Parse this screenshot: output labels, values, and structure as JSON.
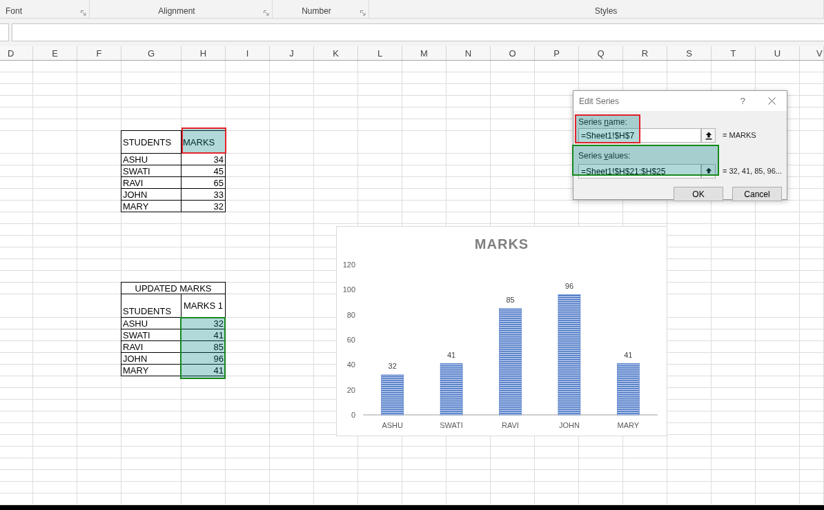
{
  "ribbon": {
    "groups": [
      {
        "label": "Font",
        "launcher": true
      },
      {
        "label": "Alignment",
        "launcher": true
      },
      {
        "label": "Number",
        "launcher": true
      },
      {
        "label": "Styles",
        "launcher": false
      }
    ]
  },
  "column_headers": [
    "D",
    "E",
    "F",
    "G",
    "H",
    "I",
    "J",
    "K",
    "L",
    "M",
    "N",
    "O",
    "P",
    "Q",
    "R",
    "S",
    "T",
    "U",
    "V"
  ],
  "table_1": {
    "columns": [
      {
        "label": "STUDENTS",
        "highlighted": false
      },
      {
        "label": "MARKS",
        "highlighted": true
      }
    ],
    "rows": [
      {
        "student": "ASHU",
        "marks": "34"
      },
      {
        "student": "SWATI",
        "marks": "45"
      },
      {
        "student": "RAVI",
        "marks": "65"
      },
      {
        "student": "JOHN",
        "marks": "33"
      },
      {
        "student": "MARY",
        "marks": "32"
      }
    ]
  },
  "table_2": {
    "title": "UPDATED MARKS",
    "columns": [
      {
        "label": "STUDENTS"
      },
      {
        "label": "MARKS 1"
      }
    ],
    "values_highlighted": true,
    "rows": [
      {
        "student": "ASHU",
        "marks": "32"
      },
      {
        "student": "SWATI",
        "marks": "41"
      },
      {
        "student": "RAVI",
        "marks": "85"
      },
      {
        "student": "JOHN",
        "marks": "96"
      },
      {
        "student": "MARY",
        "marks": "41"
      }
    ]
  },
  "chart": {
    "chart_data": {
      "type": "bar",
      "title": "MARKS",
      "categories": [
        "ASHU",
        "SWATI",
        "RAVI",
        "JOHN",
        "MARY"
      ],
      "series": [
        {
          "color": "#4472c4",
          "values": [
            32,
            41,
            85,
            96,
            41
          ]
        }
      ],
      "ylim": [
        0,
        120
      ],
      "yticks": [
        0,
        20,
        40,
        60,
        80,
        100,
        120
      ],
      "data_labels": true
    }
  },
  "dialog": {
    "title": "Edit Series",
    "help": "?",
    "series_name": {
      "label": {
        "before": "Series ",
        "key": "n",
        "after": "ame:"
      },
      "value": "=Sheet1!$H$7",
      "preview": "= MARKS",
      "highlighted": true
    },
    "series_values": {
      "label": {
        "before": "Series ",
        "key": "v",
        "after": "alues:"
      },
      "value": "=Sheet1!$H$21:$H$25",
      "preview": "= 32, 41, 85, 96...",
      "highlighted": true
    },
    "buttons": [
      "OK",
      "Cancel"
    ]
  }
}
